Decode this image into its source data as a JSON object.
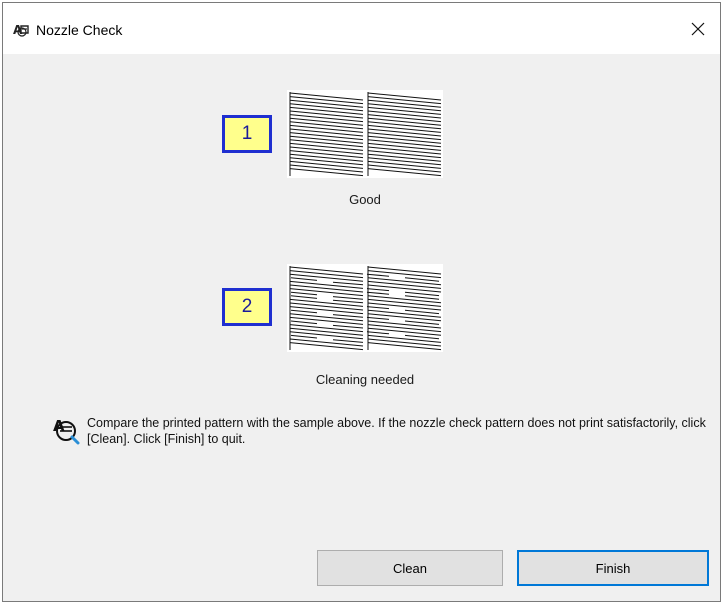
{
  "window": {
    "title": "Nozzle Check"
  },
  "samples": [
    {
      "number": "1",
      "caption": "Good",
      "state": "good"
    },
    {
      "number": "2",
      "caption": "Cleaning needed",
      "state": "broken"
    }
  ],
  "message": "Compare the printed pattern with the sample above. If the nozzle check pattern does not print satisfactorily, click [Clean]. Click [Finish] to quit.",
  "buttons": {
    "clean": "Clean",
    "finish": "Finish"
  },
  "colors": {
    "callout_fill": "#ffff8c",
    "callout_border": "#1f2fd0",
    "default_button_border": "#0078d7"
  }
}
